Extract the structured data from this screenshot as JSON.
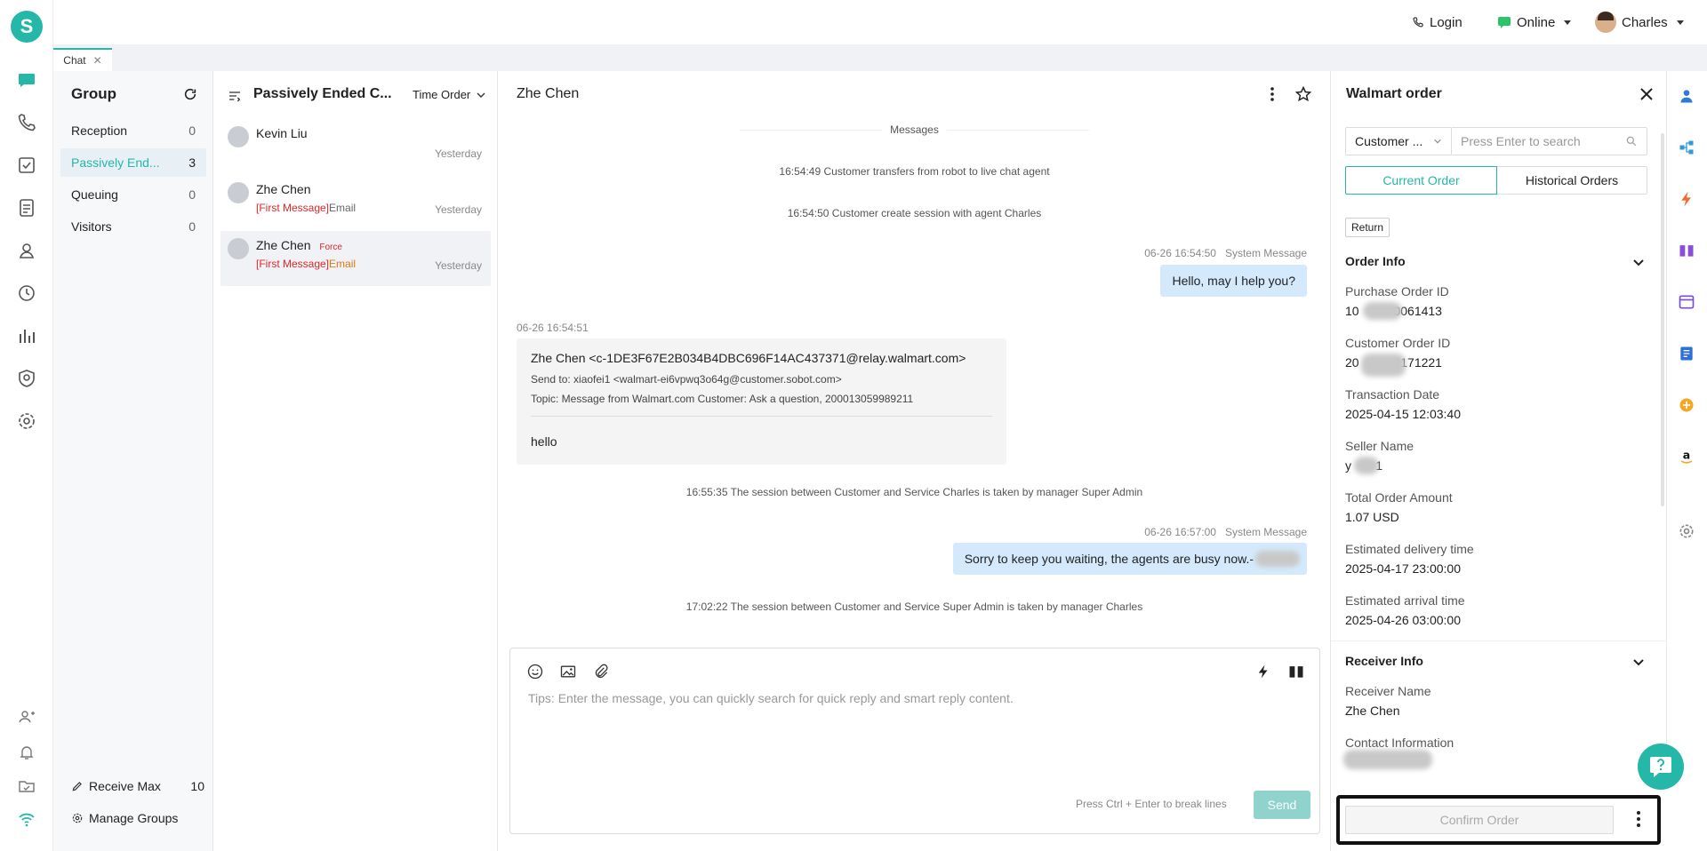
{
  "brand": {
    "logo_letter": "S",
    "accent": "#25b7a8"
  },
  "topbar": {
    "login_label": "Login",
    "status_label": "Online",
    "user_name": "Charles"
  },
  "tabs": [
    {
      "label": "Chat"
    }
  ],
  "group": {
    "title": "Group",
    "items": [
      {
        "label": "Reception",
        "count": "0"
      },
      {
        "label": "Passively End...",
        "count": "3"
      },
      {
        "label": "Queuing",
        "count": "0"
      },
      {
        "label": "Visitors",
        "count": "0"
      }
    ],
    "receive_max_label": "Receive Max",
    "receive_max_value": "10",
    "manage_groups_label": "Manage Groups"
  },
  "conversations": {
    "title": "Passively Ended C...",
    "sort_label": "Time Order",
    "items": [
      {
        "name": "Kevin Liu",
        "time": "Yesterday"
      },
      {
        "name": "Zhe Chen",
        "tag": "[First Message]",
        "channel": "Email",
        "time": "Yesterday"
      },
      {
        "name": "Zhe Chen",
        "badge": "Force",
        "tag": "[First Message]",
        "channel": "Email",
        "time": "Yesterday"
      }
    ]
  },
  "chat": {
    "title": "Zhe Chen",
    "messages_divider": "Messages",
    "sys1": "16:54:49 Customer transfers from robot to live chat agent",
    "sys2": "16:54:50 Customer create session with agent Charles",
    "msg1_time": "06-26 16:54:50",
    "msg1_sender": "System Message",
    "msg1_text": "Hello, may I help you?",
    "email_time": "06-26 16:54:51",
    "email_from": "Zhe Chen <c-1DE3F67E2B034B4DBC696F14AC437371@relay.walmart.com>",
    "email_to": "Send to: xiaofei1 <walmart-ei6vpwq3o64g@customer.sobot.com>",
    "email_topic": "Topic: Message from Walmart.com Customer:  Ask a question, 200013059989211",
    "email_body": "hello",
    "sys3": "16:55:35 The session between Customer and Service Charles is taken by manager Super Admin",
    "msg2_time": "06-26 16:57:00",
    "msg2_sender": "System Message",
    "msg2_text": "Sorry to keep you waiting, the agents are busy now.-",
    "sys4": "17:02:22 The session between Customer and Service Super Admin is taken by manager Charles",
    "composer_placeholder": "Tips: Enter the message, you can quickly search for quick reply and smart reply content.",
    "composer_hint": "Press Ctrl + Enter to break lines",
    "send_label": "Send"
  },
  "order_panel": {
    "title": "Walmart order",
    "filter_select": "Customer ...",
    "search_placeholder": "Press Enter to search",
    "tab_current": "Current Order",
    "tab_history": "Historical Orders",
    "return_label": "Return",
    "order_info_title": "Order Info",
    "fields": [
      {
        "label": "Purchase Order ID",
        "value": "10          0061413"
      },
      {
        "label": "Customer Order ID",
        "value": "20          2171221"
      },
      {
        "label": "Transaction Date",
        "value": "2025-04-15 12:03:40"
      },
      {
        "label": "Seller Name",
        "value": "y       1"
      },
      {
        "label": "Total Order Amount",
        "value": "1.07 USD"
      },
      {
        "label": "Estimated delivery time",
        "value": "2025-04-17 23:00:00"
      },
      {
        "label": "Estimated arrival time",
        "value": "2025-04-26 03:00:00"
      }
    ],
    "receiver_info_title": "Receiver Info",
    "receiver_fields": [
      {
        "label": "Receiver Name",
        "value": "Zhe Chen"
      },
      {
        "label": "Contact Information",
        "value": ""
      }
    ],
    "confirm_label": "Confirm Order"
  }
}
